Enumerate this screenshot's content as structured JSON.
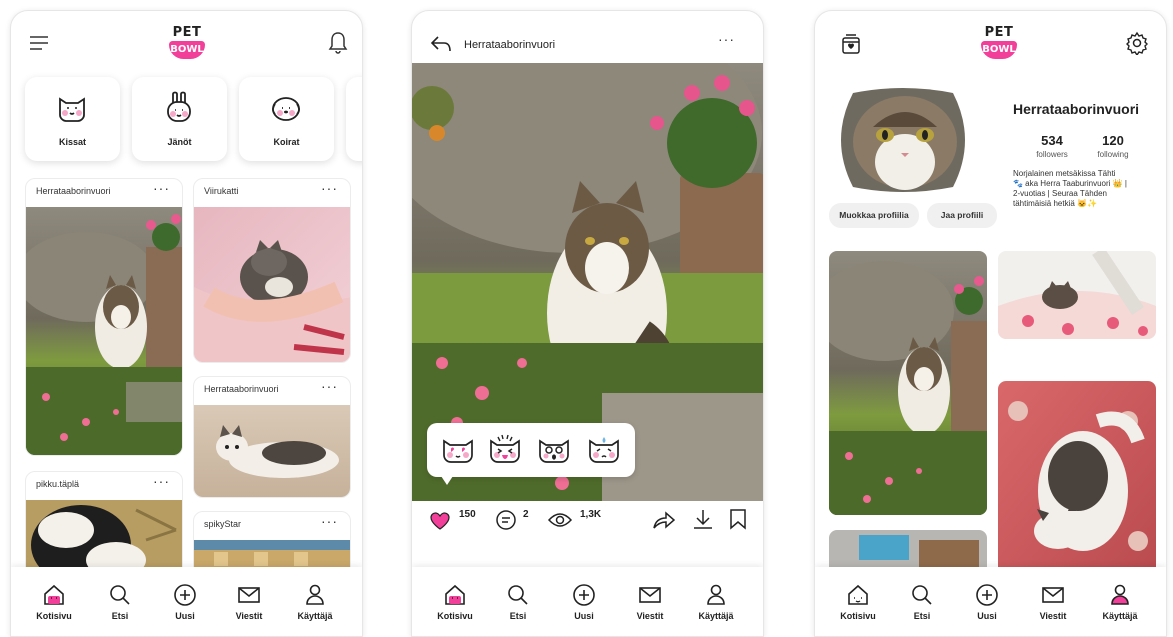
{
  "home": {
    "categories": [
      {
        "label": "Kissat",
        "icon": "cat-face-icon"
      },
      {
        "label": "Jänöt",
        "icon": "bunny-face-icon"
      },
      {
        "label": "Koirat",
        "icon": "dog-face-icon"
      }
    ],
    "posts": [
      {
        "user": "Herrataaborinvuori",
        "more": "···"
      },
      {
        "user": "Viirukatti",
        "more": "···"
      },
      {
        "user": "Herrataaborinvuori",
        "more": "···"
      },
      {
        "user": "pikku.täplä",
        "more": "···"
      },
      {
        "user": "spikyStar",
        "more": "···"
      }
    ]
  },
  "post": {
    "user": "Herrataaborinvuori",
    "more": "···",
    "reactions": [
      "love-cat-icon",
      "cheer-cat-icon",
      "wow-cat-icon",
      "sad-cat-icon"
    ],
    "likes": "150",
    "comments": "2",
    "views": "1,3K"
  },
  "profile": {
    "name": "Herrataaborinvuori",
    "followers_count": "534",
    "followers_label": "followers",
    "following_count": "120",
    "following_label": "following",
    "bio_lines": [
      "Norjalainen metsäkissa Tähti",
      "🐾 aka Herra Taaburinvuori 👑 |",
      "2-vuotias | Seuraa Tähden",
      "tähtimäisiä hetkiä 🐱✨"
    ],
    "edit_button": "Muokkaa profiilia",
    "share_button": "Jaa profiili"
  },
  "nav": {
    "home": "Kotisivu",
    "search": "Etsi",
    "new": "Uusi",
    "messages": "Viestit",
    "user": "Käyttäjä"
  },
  "colors": {
    "accent": "#f23f9a",
    "text": "#222222",
    "card": "#ffffff"
  }
}
